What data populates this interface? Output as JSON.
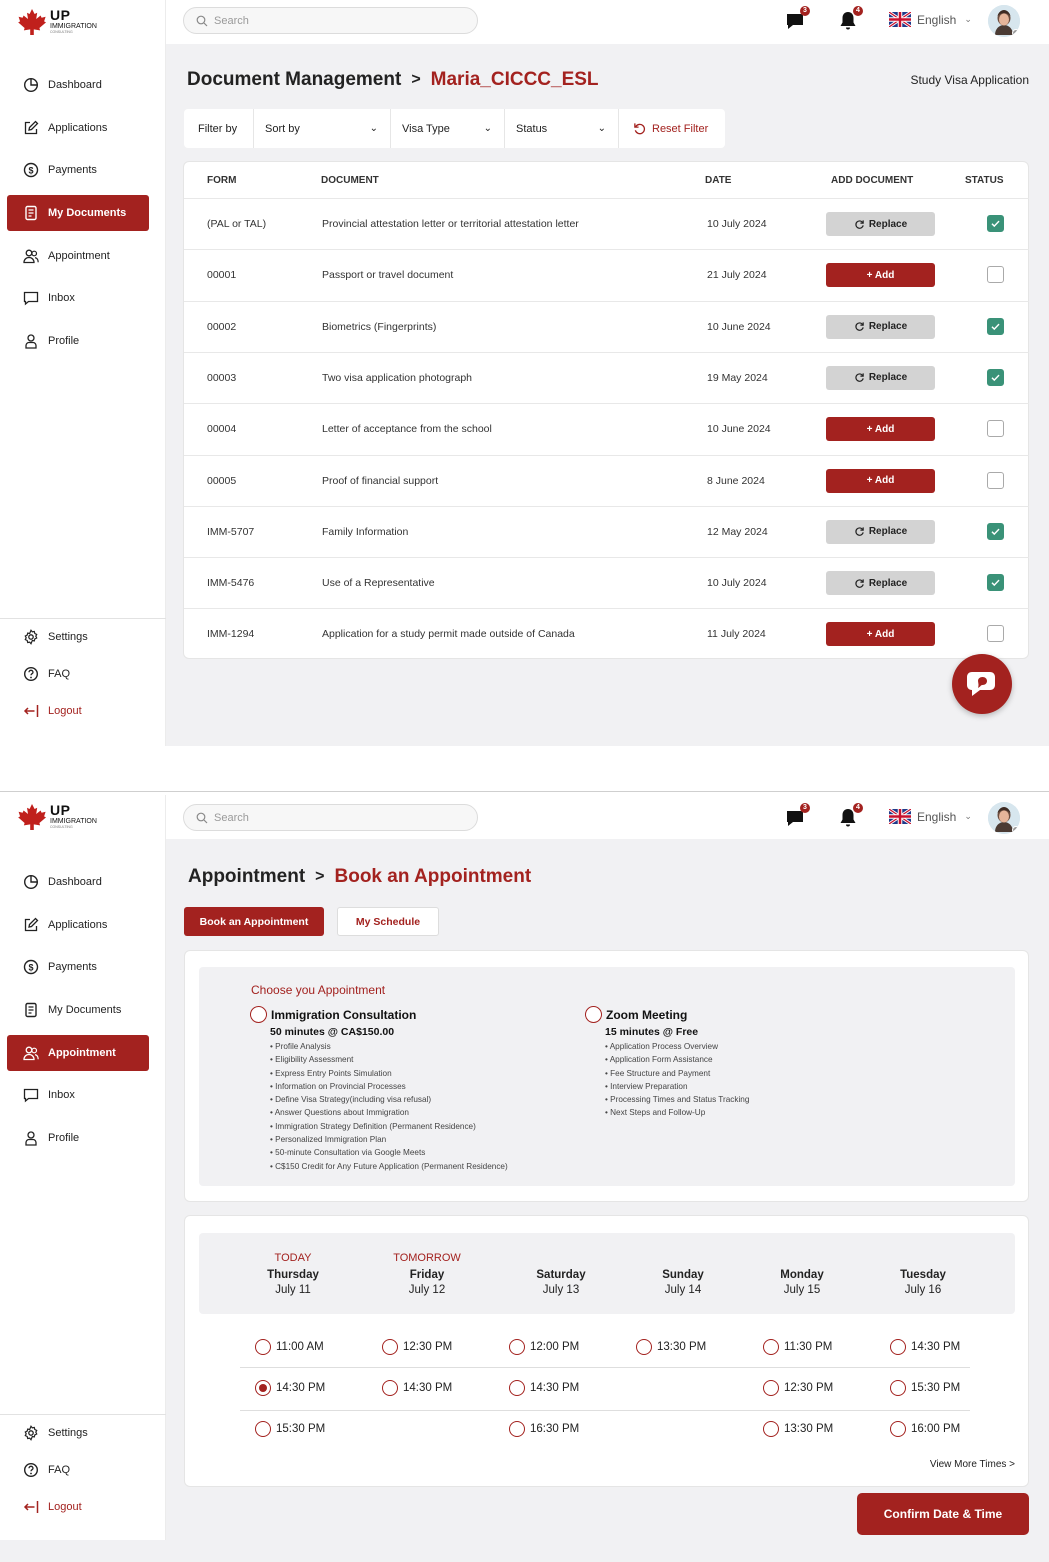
{
  "brand": {
    "name": "UP",
    "sub": "IMMIGRATION",
    "tagline": "CONSULTING"
  },
  "search": {
    "placeholder": "Search"
  },
  "header": {
    "messages_count": "3",
    "notifications_count": "4",
    "language": "English"
  },
  "sidebar": {
    "items": [
      {
        "label": "Dashboard",
        "icon": "pie-chart-icon"
      },
      {
        "label": "Applications",
        "icon": "edit-icon"
      },
      {
        "label": "Payments",
        "icon": "dollar-circle-icon"
      },
      {
        "label": "My Documents",
        "icon": "document-icon"
      },
      {
        "label": "Appointment",
        "icon": "users-icon"
      },
      {
        "label": "Inbox",
        "icon": "chat-icon"
      },
      {
        "label": "Profile",
        "icon": "user-icon"
      }
    ],
    "bottom": [
      {
        "label": "Settings",
        "icon": "gear-icon"
      },
      {
        "label": "FAQ",
        "icon": "help-icon"
      },
      {
        "label": "Logout",
        "icon": "logout-icon"
      }
    ]
  },
  "docs": {
    "breadcrumb_root": "Document Management",
    "breadcrumb_current": "Maria_CICCC_ESL",
    "context_label": "Study Visa Application",
    "filters": {
      "filter_by": "Filter by",
      "sort_by": "Sort by",
      "visa_type": "Visa Type",
      "status": "Status",
      "reset": "Reset Filter"
    },
    "columns": {
      "form": "FORM",
      "document": "DOCUMENT",
      "date": "DATE",
      "add_document": "ADD DOCUMENT",
      "status": "STATUS"
    },
    "button_replace": "Replace",
    "button_add": "+ Add",
    "rows": [
      {
        "form": "(PAL or TAL)",
        "document": "Provincial attestation letter or territorial attestation letter",
        "date": "10 July 2024",
        "action": "replace",
        "checked": true
      },
      {
        "form": "00001",
        "document": "Passport or travel document",
        "date": "21 July 2024",
        "action": "add",
        "checked": false
      },
      {
        "form": "00002",
        "document": "Biometrics (Fingerprints)",
        "date": "10 June 2024",
        "action": "replace",
        "checked": true
      },
      {
        "form": "00003",
        "document": "Two visa application photograph",
        "date": "19 May 2024",
        "action": "replace",
        "checked": true
      },
      {
        "form": "00004",
        "document": "Letter of acceptance from the school",
        "date": "10 June 2024",
        "action": "add",
        "checked": false
      },
      {
        "form": "00005",
        "document": "Proof of financial support",
        "date": "8 June 2024",
        "action": "add",
        "checked": false
      },
      {
        "form": "IMM-5707",
        "document": "Family Information",
        "date": "12 May 2024",
        "action": "replace",
        "checked": true
      },
      {
        "form": "IMM-5476",
        "document": "Use of a Representative",
        "date": "10 July 2024",
        "action": "replace",
        "checked": true
      },
      {
        "form": "IMM-1294",
        "document": "Application for a study permit made outside of Canada",
        "date": "11 July 2024",
        "action": "add",
        "checked": false
      }
    ]
  },
  "appointment": {
    "breadcrumb_root": "Appointment",
    "breadcrumb_current": "Book an Appointment",
    "tabs": {
      "book": "Book an Appointment",
      "schedule": "My Schedule"
    },
    "choose_title": "Choose you Appointment",
    "options": [
      {
        "title": "Immigration Consultation",
        "price": "50 minutes @ CA$150.00",
        "features": [
          "• Profile Analysis",
          "• Eligibility Assessment",
          "• Express Entry Points Simulation",
          "• Information on Provincial Processes",
          "• Define Visa Strategy(including visa refusal)",
          "• Answer Questions about Immigration",
          "• Immigration Strategy Definition (Permanent Residence)",
          "• Personalized Immigration Plan",
          "• 50-minute Consultation via Google Meets",
          "• C$150 Credit for Any Future Application (Permanent Residence)"
        ]
      },
      {
        "title": "Zoom Meeting",
        "price": "15 minutes @ Free",
        "features": [
          "• Application Process Overview",
          "• Application Form Assistance",
          "• Fee Structure and Payment",
          "• Interview Preparation",
          "• Processing Times and Status Tracking",
          "• Next Steps and Follow-Up"
        ]
      }
    ],
    "days": [
      {
        "tag": "TODAY",
        "name": "Thursday",
        "date": "July 11",
        "slots": [
          "11:00 AM",
          "14:30 PM",
          "15:30 PM"
        ]
      },
      {
        "tag": "TOMORROW",
        "name": "Friday",
        "date": "July 12",
        "slots": [
          "12:30 PM",
          "14:30 PM"
        ]
      },
      {
        "tag": "",
        "name": "Saturday",
        "date": "July 13",
        "slots": [
          "12:00 PM",
          "14:30 PM",
          "16:30 PM"
        ]
      },
      {
        "tag": "",
        "name": "Sunday",
        "date": "July 14",
        "slots": [
          "13:30 PM"
        ]
      },
      {
        "tag": "",
        "name": "Monday",
        "date": "July 15",
        "slots": [
          "11:30 PM",
          "12:30 PM",
          "13:30 PM"
        ]
      },
      {
        "tag": "",
        "name": "Tuesday",
        "date": "July 16",
        "slots": [
          "14:30 PM",
          "15:30 PM",
          "16:00 PM"
        ]
      }
    ],
    "selected_slot": "Thursday 14:30 PM",
    "view_more": "View More Times >",
    "confirm": "Confirm Date & Time"
  },
  "colors": {
    "accent": "#a3221f",
    "check": "#3a9278",
    "background": "#f1f1f3"
  }
}
